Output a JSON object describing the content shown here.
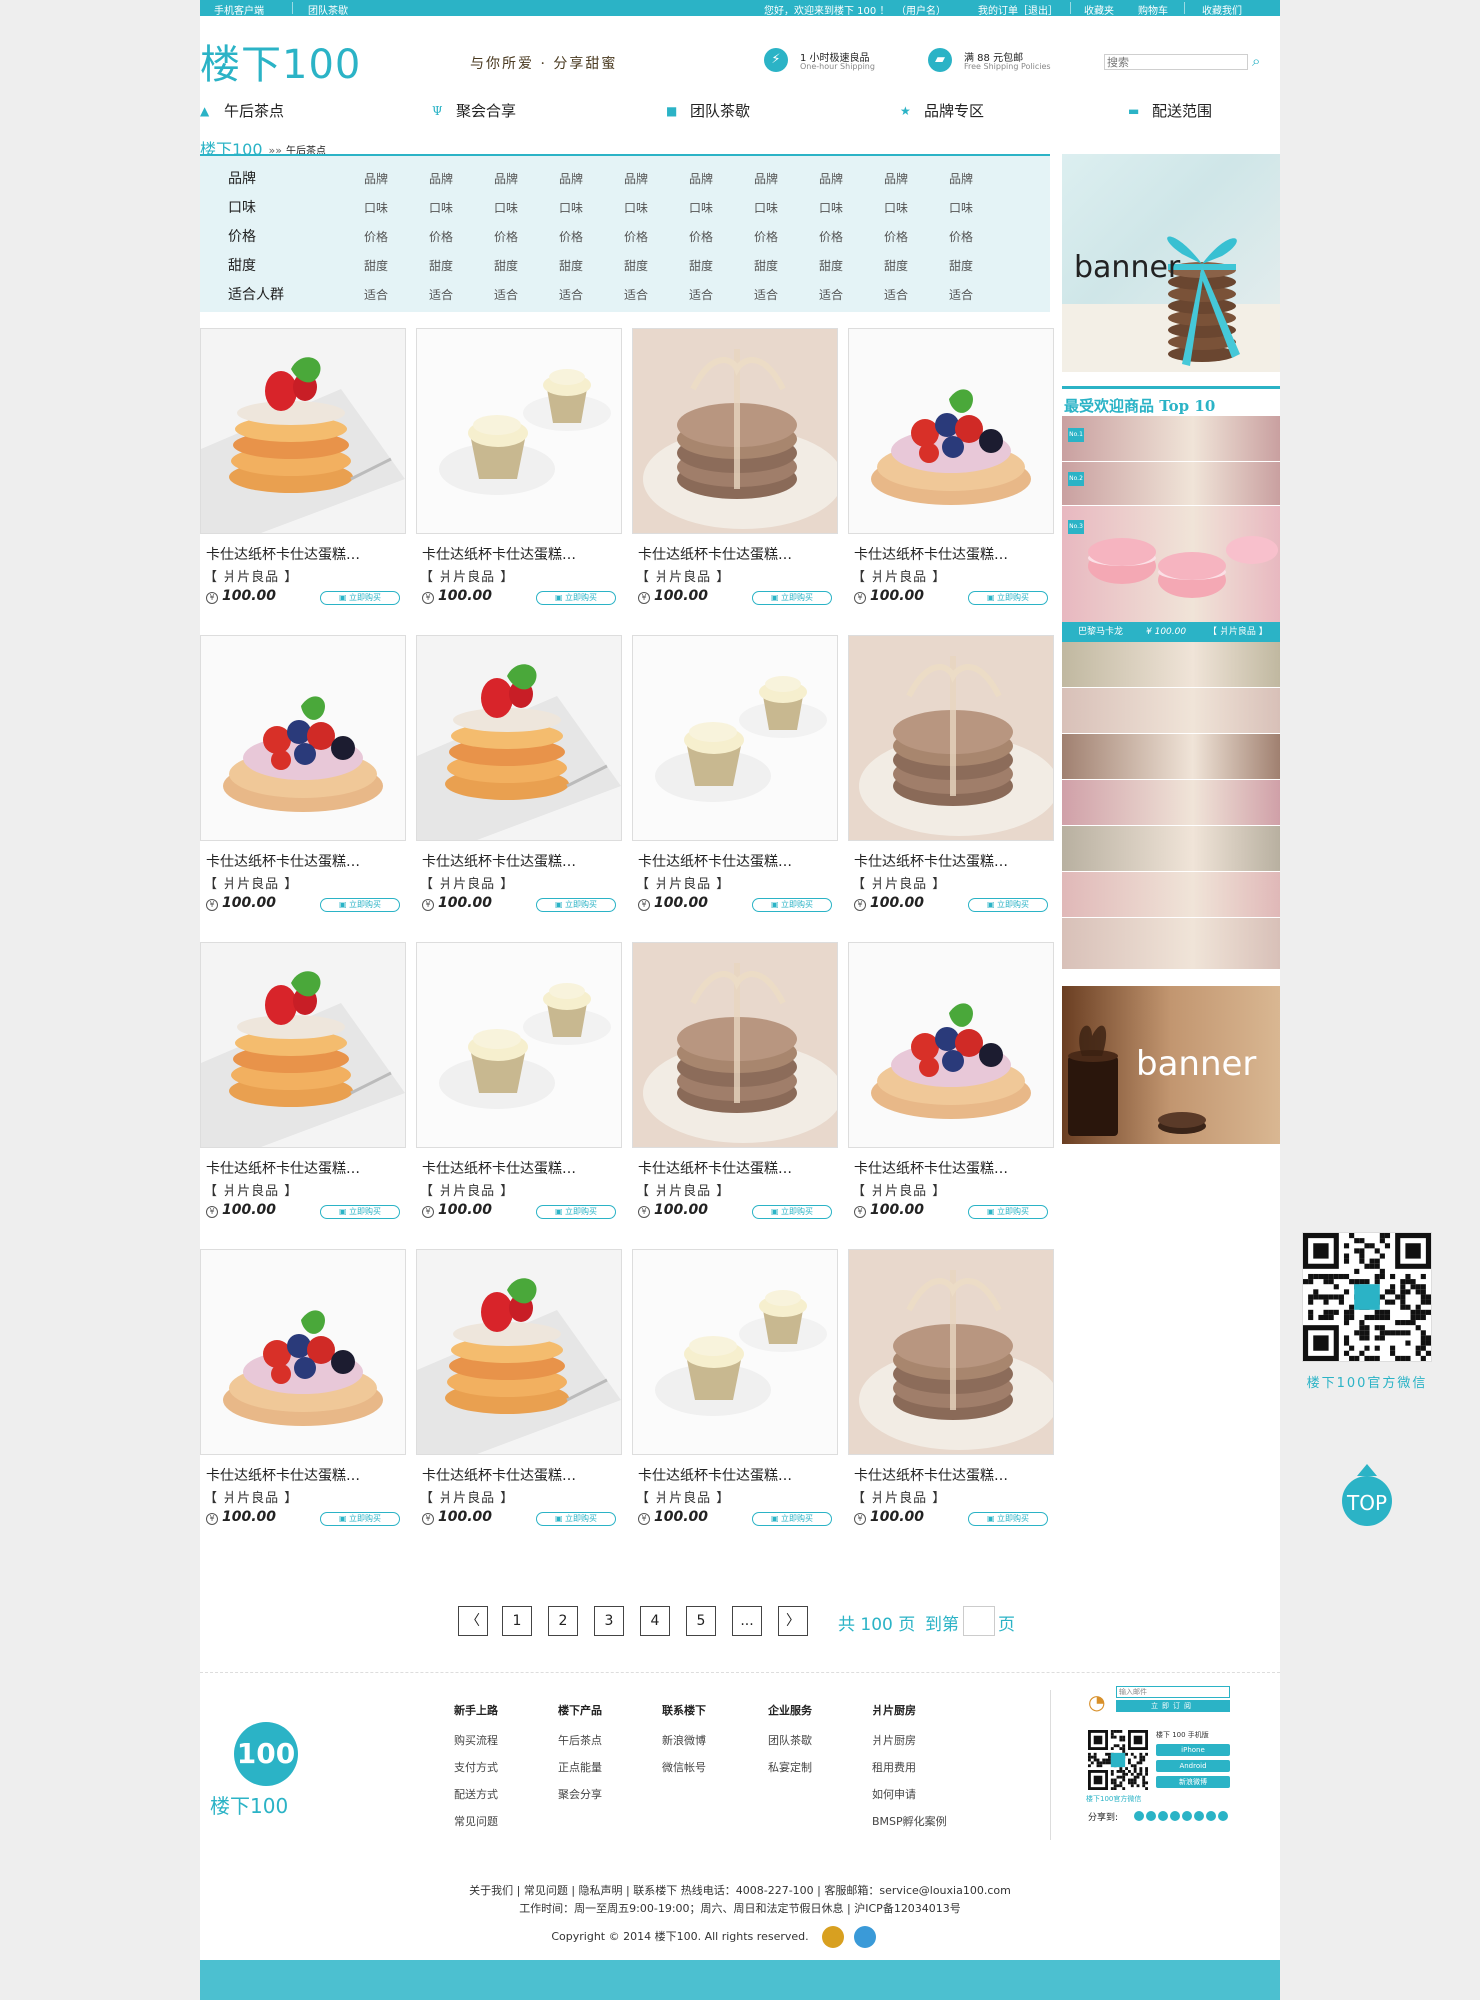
{
  "topbar": {
    "left": [
      "手机客户端",
      "团队茶歇"
    ],
    "greeting": "您好，欢迎来到楼下 100 ！",
    "username": "（用户名）",
    "orders": "我的订单［退出］",
    "favorites": "收藏夹",
    "cart": "购物车",
    "bookmark": "收藏我们"
  },
  "header": {
    "logo": "楼下100",
    "slogan": "与你所爱 · 分享甜蜜",
    "feature1_title": "1 小时极速良品",
    "feature1_sub": "One-hour Shipping",
    "feature2_title": "满 88 元包邮",
    "feature2_sub": "Free Shipping Policies",
    "search_placeholder": "搜索"
  },
  "nav": [
    "午后茶点",
    "聚会合享",
    "团队茶歇",
    "品牌专区",
    "配送范围"
  ],
  "breadcrumb": {
    "brand": "楼下100",
    "arrows": "»»",
    "current": "午后茶点"
  },
  "filters": [
    {
      "label": "品牌",
      "options": [
        "品牌",
        "品牌",
        "品牌",
        "品牌",
        "品牌",
        "品牌",
        "品牌",
        "品牌",
        "品牌",
        "品牌"
      ]
    },
    {
      "label": "口味",
      "options": [
        "口味",
        "口味",
        "口味",
        "口味",
        "口味",
        "口味",
        "口味",
        "口味",
        "口味",
        "口味"
      ]
    },
    {
      "label": "价格",
      "options": [
        "价格",
        "价格",
        "价格",
        "价格",
        "价格",
        "价格",
        "价格",
        "价格",
        "价格",
        "价格"
      ]
    },
    {
      "label": "甜度",
      "options": [
        "甜度",
        "甜度",
        "甜度",
        "甜度",
        "甜度",
        "甜度",
        "甜度",
        "甜度",
        "甜度",
        "甜度"
      ]
    },
    {
      "label": "适合人群",
      "options": [
        "适合",
        "适合",
        "适合",
        "适合",
        "适合",
        "适合",
        "适合",
        "适合",
        "适合",
        "适合"
      ]
    }
  ],
  "products": [
    {
      "img": "layer",
      "name": "卡仕达纸杯卡仕达蛋糕…",
      "brand": "【 爿片良品 】",
      "price": "100.00",
      "buy": "立即购买"
    },
    {
      "img": "cupcake",
      "name": "卡仕达纸杯卡仕达蛋糕…",
      "brand": "【 爿片良品 】",
      "price": "100.00",
      "buy": "立即购买"
    },
    {
      "img": "cookie",
      "name": "卡仕达纸杯卡仕达蛋糕…",
      "brand": "【 爿片良品 】",
      "price": "100.00",
      "buy": "立即购买"
    },
    {
      "img": "tart",
      "name": "卡仕达纸杯卡仕达蛋糕…",
      "brand": "【 爿片良品 】",
      "price": "100.00",
      "buy": "立即购买"
    },
    {
      "img": "tart",
      "name": "卡仕达纸杯卡仕达蛋糕…",
      "brand": "【 爿片良品 】",
      "price": "100.00",
      "buy": "立即购买"
    },
    {
      "img": "layer",
      "name": "卡仕达纸杯卡仕达蛋糕…",
      "brand": "【 爿片良品 】",
      "price": "100.00",
      "buy": "立即购买"
    },
    {
      "img": "cupcake",
      "name": "卡仕达纸杯卡仕达蛋糕…",
      "brand": "【 爿片良品 】",
      "price": "100.00",
      "buy": "立即购买"
    },
    {
      "img": "cookie",
      "name": "卡仕达纸杯卡仕达蛋糕…",
      "brand": "【 爿片良品 】",
      "price": "100.00",
      "buy": "立即购买"
    },
    {
      "img": "layer",
      "name": "卡仕达纸杯卡仕达蛋糕…",
      "brand": "【 爿片良品 】",
      "price": "100.00",
      "buy": "立即购买"
    },
    {
      "img": "cupcake",
      "name": "卡仕达纸杯卡仕达蛋糕…",
      "brand": "【 爿片良品 】",
      "price": "100.00",
      "buy": "立即购买"
    },
    {
      "img": "cookie",
      "name": "卡仕达纸杯卡仕达蛋糕…",
      "brand": "【 爿片良品 】",
      "price": "100.00",
      "buy": "立即购买"
    },
    {
      "img": "tart",
      "name": "卡仕达纸杯卡仕达蛋糕…",
      "brand": "【 爿片良品 】",
      "price": "100.00",
      "buy": "立即购买"
    },
    {
      "img": "tart",
      "name": "卡仕达纸杯卡仕达蛋糕…",
      "brand": "【 爿片良品 】",
      "price": "100.00",
      "buy": "立即购买"
    },
    {
      "img": "layer",
      "name": "卡仕达纸杯卡仕达蛋糕…",
      "brand": "【 爿片良品 】",
      "price": "100.00",
      "buy": "立即购买"
    },
    {
      "img": "cupcake",
      "name": "卡仕达纸杯卡仕达蛋糕…",
      "brand": "【 爿片良品 】",
      "price": "100.00",
      "buy": "立即购买"
    },
    {
      "img": "cookie",
      "name": "卡仕达纸杯卡仕达蛋糕…",
      "brand": "【 爿片良品 】",
      "price": "100.00",
      "buy": "立即购买"
    }
  ],
  "sidebar": {
    "banner1": "banner",
    "top10_title": "最受欢迎商品 Top 10",
    "ranks": [
      "No.1",
      "No.2",
      "No.3"
    ],
    "featured_name": "巴黎马卡龙",
    "featured_price": "¥ 100.00",
    "featured_brand": "【 爿片良品 】",
    "banner2": "banner",
    "strip_colors": [
      "#c9a0a0",
      "#9a8a70",
      "#e8b8c0",
      "#c0b8a0",
      "#d8c0b8",
      "#a08070",
      "#d0a0a8",
      "#b8b0a0",
      "#e0b8b8"
    ]
  },
  "float": {
    "qr_label": "楼下100官方微信",
    "top": "TOP"
  },
  "pagination": {
    "prev": "〈",
    "pages": [
      "1",
      "2",
      "3",
      "4",
      "5",
      "..."
    ],
    "next": "〉",
    "total": "共 100 页",
    "goto": "到第",
    "unit": "页"
  },
  "footer": {
    "columns": [
      {
        "title": "新手上路",
        "items": [
          "购买流程",
          "支付方式",
          "配送方式",
          "常见问题"
        ]
      },
      {
        "title": "楼下产品",
        "items": [
          "午后茶点",
          "正点能量",
          "聚会分享"
        ]
      },
      {
        "title": "联系楼下",
        "items": [
          "新浪微博",
          "微信帐号"
        ]
      },
      {
        "title": "企业服务",
        "items": [
          "团队茶歇",
          "私宴定制"
        ]
      },
      {
        "title": "爿片厨房",
        "items": [
          "爿片厨房",
          "租用费用",
          "如何申请",
          "BMSP孵化案例"
        ]
      }
    ],
    "logo_text": "楼下100",
    "logo_mark": "100",
    "subscribe_placeholder": "输入邮件",
    "subscribe_btn": "立即订阅",
    "mobile_title": "楼下 100 手机版",
    "mobile_buttons": [
      "iPhone",
      "Android",
      "新浪微博"
    ],
    "qr_caption": "楼下100官方微信",
    "share_label": "分享到:",
    "links": "关于我们 | 常见问题 | 隐私声明 | 联系楼下 热线电话：4008-227-100 | 客服邮箱：service@louxia100.com",
    "hours": "工作时间：周一至周五9:00-19:00；周六、周日和法定节假日休息 | 沪ICP备12034013号",
    "copyright": "Copyright © 2014 楼下100. All rights reserved."
  },
  "colors": {
    "accent": "#2bb3c6",
    "filter_bg": "#e4f3f6",
    "bottom_bar": "#4cc0d0"
  }
}
